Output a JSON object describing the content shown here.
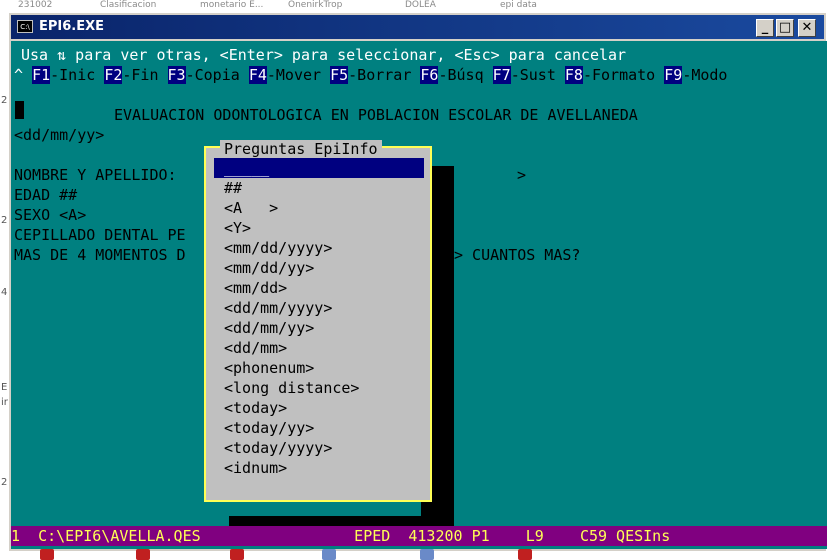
{
  "background_strip": {
    "items": [
      "231002",
      "Clasificacion",
      "monetario E...",
      "OnenirkTrop",
      "DOLEA",
      "epi data"
    ]
  },
  "left_markers": [
    "2",
    "2",
    "4",
    "E",
    "ir",
    "2"
  ],
  "window": {
    "title": "EPI6.EXE",
    "icon_label": "C:\\",
    "controls": {
      "minimize": "_",
      "maximize": "□",
      "close": "✕"
    }
  },
  "console": {
    "help_line": "Usa ⇅ para ver otras, <Enter> para seleccionar, <Esc> para cancelar",
    "caret": "^",
    "function_keys": [
      {
        "key": "F1",
        "label": "-Inic"
      },
      {
        "key": "F2",
        "label": "-Fin"
      },
      {
        "key": "F3",
        "label": "-Copia"
      },
      {
        "key": "F4",
        "label": "-Mover"
      },
      {
        "key": "F5",
        "label": "-Borrar"
      },
      {
        "key": "F6",
        "label": "-Búsq"
      },
      {
        "key": "F7",
        "label": "-Sust"
      },
      {
        "key": "F8",
        "label": "-Formato"
      },
      {
        "key": "F9",
        "label": "-Modo"
      }
    ],
    "heading": "EVALUACION ODONTOLOGICA EN POBLACION ESCOLAR DE AVELLANEDA",
    "date_field": "<dd/mm/yy>",
    "fields": {
      "nombre": "NOMBRE Y APELLIDO:",
      "nombre_end": ">",
      "edad": "EDAD ##",
      "sexo": "SEXO <A>",
      "cepillado": "CEPILLADO DENTAL PE",
      "momentos": "MAS DE 4 MOMENTOS D",
      "cuantos": "> CUANTOS MAS?"
    }
  },
  "popup": {
    "title": "Preguntas EpiInfo",
    "items": [
      "_____",
      "##",
      "<A   >",
      "<Y>",
      "<mm/dd/yyyy>",
      "<mm/dd/yy>",
      "<mm/dd>",
      "<dd/mm/yyyy>",
      "<dd/mm/yy>",
      "<dd/mm>",
      "<phonenum>",
      "<long distance>",
      "<today>",
      "<today/yy>",
      "<today/yyyy>",
      "<idnum>"
    ],
    "selected_index": 0
  },
  "status_bar": {
    "line": "1  C:\\EPI6\\AVELLA.QES                 EPED  413200 P1    L9    C59 QESIns"
  },
  "colors": {
    "console_bg": "#008080",
    "popup_bg": "#c0c0c0",
    "popup_border": "#ffff55",
    "selection": "#000080",
    "status_bg": "#800080",
    "status_fg": "#ffff55"
  }
}
